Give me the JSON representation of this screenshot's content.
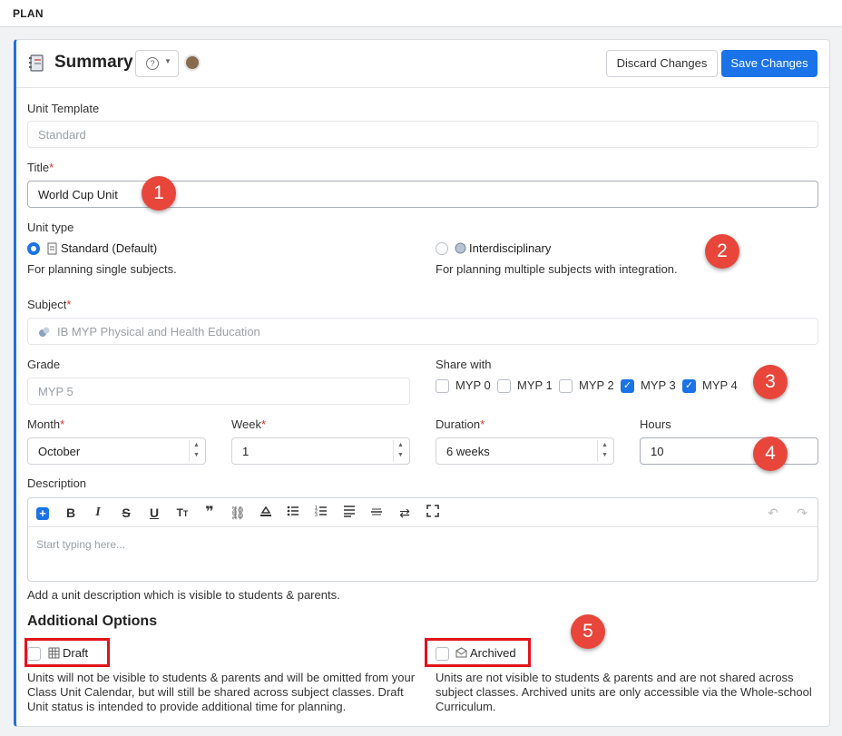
{
  "topbar": {
    "title": "PLAN"
  },
  "header": {
    "title": "Summary",
    "help_icon": "question-circle-icon",
    "discard_label": "Discard Changes",
    "save_label": "Save Changes"
  },
  "template": {
    "label": "Unit Template",
    "value": "Standard"
  },
  "title_field": {
    "label": "Title",
    "required": "*",
    "value": "World Cup Unit"
  },
  "unit_type": {
    "label": "Unit type",
    "options": [
      {
        "label": "Standard (Default)",
        "description": "For planning single subjects.",
        "selected": true
      },
      {
        "label": "Interdisciplinary",
        "description": "For planning multiple subjects with integration.",
        "selected": false
      }
    ]
  },
  "subject": {
    "label": "Subject",
    "required": "*",
    "value": "IB MYP Physical and Health Education"
  },
  "grade": {
    "label": "Grade",
    "value": "MYP 5"
  },
  "share": {
    "label": "Share with",
    "options": [
      {
        "label": "MYP 0",
        "checked": false
      },
      {
        "label": "MYP 1",
        "checked": false
      },
      {
        "label": "MYP 2",
        "checked": false
      },
      {
        "label": "MYP 3",
        "checked": true
      },
      {
        "label": "MYP 4",
        "checked": true
      }
    ]
  },
  "month": {
    "label": "Month",
    "required": "*",
    "value": "October"
  },
  "week": {
    "label": "Week",
    "required": "*",
    "value": "1"
  },
  "duration": {
    "label": "Duration",
    "required": "*",
    "value": "6 weeks"
  },
  "hours": {
    "label": "Hours",
    "value": "10"
  },
  "description": {
    "label": "Description",
    "placeholder": "Start typing here...",
    "help": "Add a unit description which is visible to students & parents."
  },
  "additional": {
    "heading": "Additional Options",
    "draft": {
      "label": "Draft",
      "help": "Units will not be visible to students & parents and will be omitted from your Class Unit Calendar, but will still be shared across subject classes. Draft Unit status is intended to provide additional time for planning."
    },
    "archived": {
      "label": "Archived",
      "help": "Units are not visible to students & parents and are not shared across subject classes. Archived units are only accessible via the Whole-school Curriculum."
    }
  },
  "callouts": [
    "1",
    "2",
    "3",
    "4",
    "5"
  ],
  "colors": {
    "accent": "#1a73e8",
    "callout": "#e8463a",
    "highlight": "#e1141b"
  }
}
